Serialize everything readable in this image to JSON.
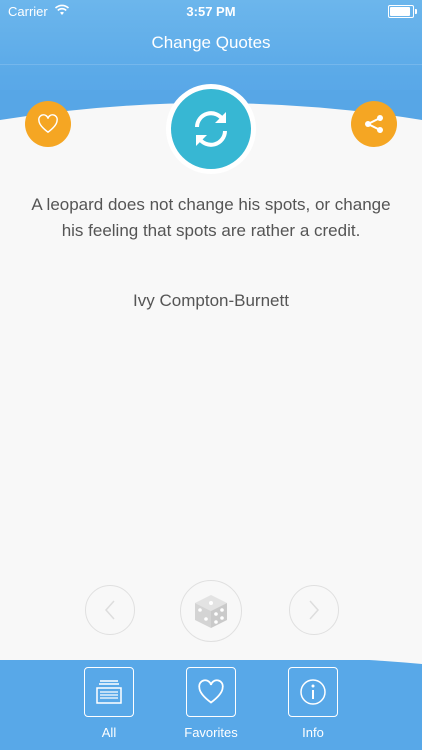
{
  "status": {
    "carrier": "Carrier",
    "time": "3:57 PM"
  },
  "header": {
    "title": "Change Quotes"
  },
  "quote": {
    "text": "A leopard does not change his spots, or change his feeling that spots are rather a credit.",
    "author": "Ivy Compton-Burnett"
  },
  "actions": {
    "favorite_icon": "heart-icon",
    "refresh_icon": "refresh-icon",
    "share_icon": "share-icon"
  },
  "navigation": {
    "prev_icon": "chevron-left-icon",
    "random_icon": "dice-icon",
    "next_icon": "chevron-right-icon"
  },
  "tabs": [
    {
      "label": "All",
      "icon": "stack-icon"
    },
    {
      "label": "Favorites",
      "icon": "heart-icon"
    },
    {
      "label": "Info",
      "icon": "info-icon"
    }
  ],
  "colors": {
    "header": "#5aa9e8",
    "accent": "#37b7d3",
    "orange": "#f5a623"
  }
}
